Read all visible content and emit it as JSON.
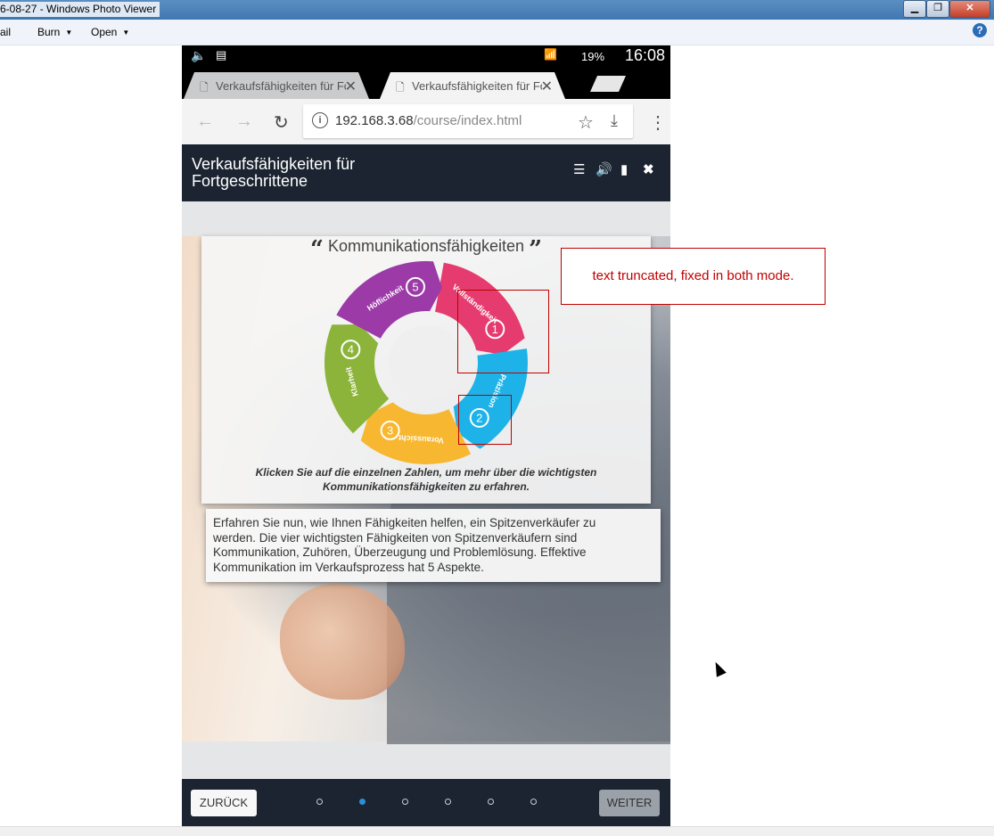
{
  "window": {
    "title": "6-08-27 - Windows Photo Viewer"
  },
  "menu": {
    "items": [
      "ail",
      "Burn",
      "Open"
    ]
  },
  "status_bar": {
    "battery": "19%",
    "time": "16:08"
  },
  "browser": {
    "tabs": [
      {
        "label": "Verkaufsfähigkeiten für Fortgeschrittene",
        "active": false
      },
      {
        "label": "Verkaufsfähigkeiten für Fortgeschrittene",
        "active": true
      }
    ],
    "url_host": "192.168.3.68",
    "url_path": "/course/index.html"
  },
  "course": {
    "title": "Verkaufsfähigkeiten für Fortgeschrittene",
    "card_title": "Kommunikationsfähigkeiten",
    "quote_open": "“",
    "quote_close": "”",
    "segments": [
      {
        "number": "1",
        "label": "Vollständigkeit",
        "color": "#e63b6f"
      },
      {
        "number": "2",
        "label": "Präzision",
        "color": "#1eb3e8"
      },
      {
        "number": "3",
        "label": "Voraussicht",
        "color": "#f7b731"
      },
      {
        "number": "4",
        "label": "Klarheit",
        "color": "#8cb43a"
      },
      {
        "number": "5",
        "label": "Höflichkeit",
        "color": "#9c3aa8"
      }
    ],
    "caption": "Klicken Sie auf die einzelnen Zahlen, um mehr über die wichtigsten Kommunikationsfähigkeiten zu erfahren.",
    "body_text": "Erfahren Sie nun, wie Ihnen Fähigkeiten helfen, ein Spitzenverkäufer zu werden. Die vier wichtigsten Fähigkeiten von Spitzenverkäufern sind Kommunikation, Zuhören, Überzeugung und Problemlösung. Effektive Kommunikation im Verkaufsprozess hat 5 Aspekte.",
    "back_label": "ZURÜCK",
    "next_label": "WEITER",
    "pages_total": 6,
    "current_page": 2
  },
  "annotation": {
    "text": "text truncated, fixed in both mode."
  }
}
